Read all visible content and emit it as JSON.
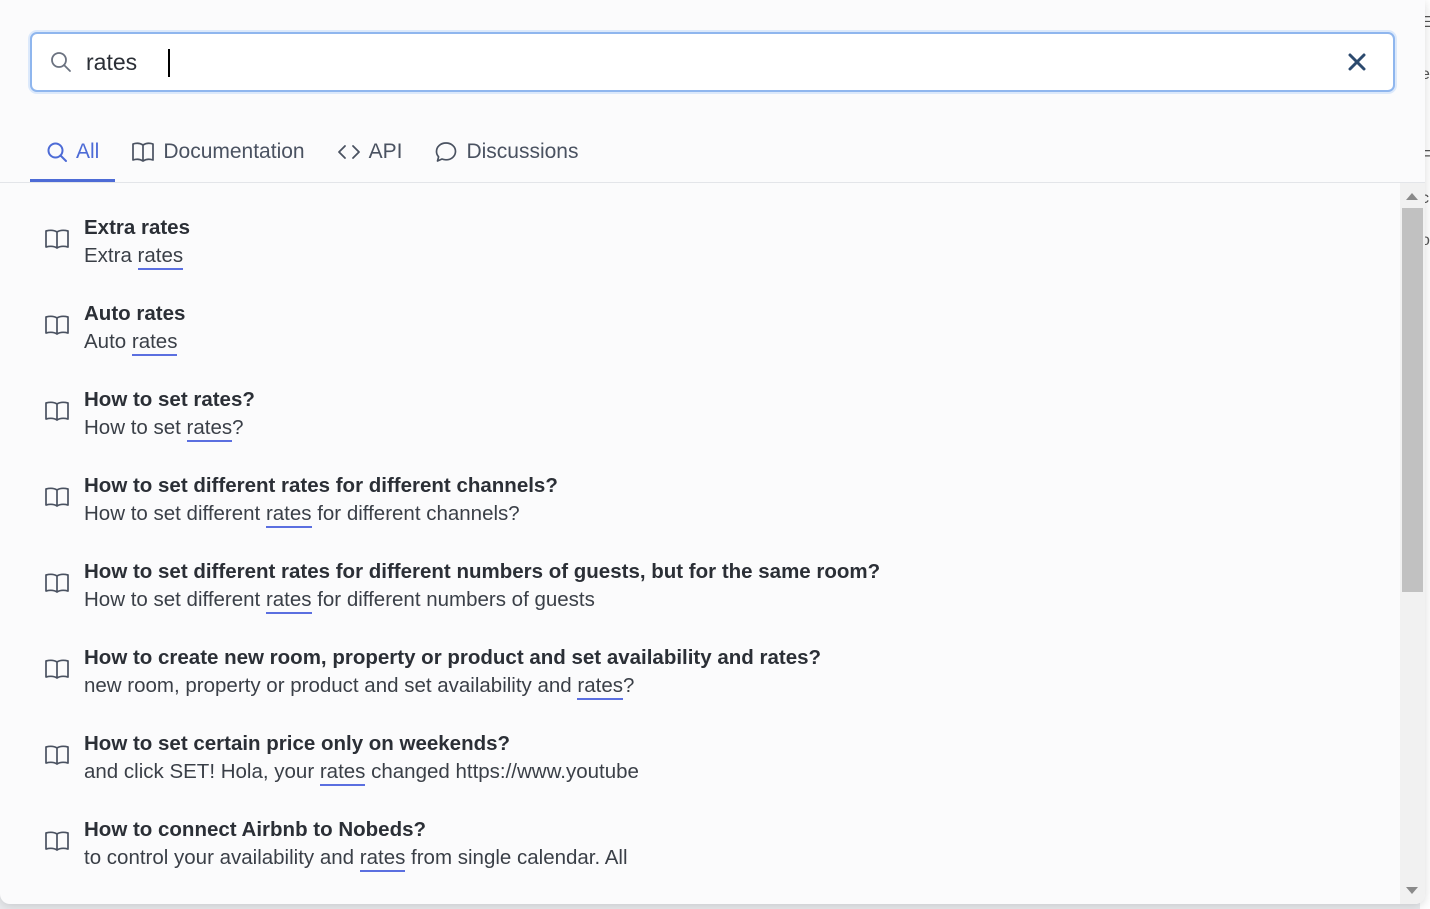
{
  "search": {
    "value": "rates",
    "clear_label": "×"
  },
  "tabs": [
    {
      "label": "All",
      "icon": "search-icon",
      "active": true
    },
    {
      "label": "Documentation",
      "icon": "book-icon",
      "active": false
    },
    {
      "label": "API",
      "icon": "code-icon",
      "active": false
    },
    {
      "label": "Discussions",
      "icon": "chat-bubble-icon",
      "active": false
    }
  ],
  "results": [
    {
      "title": "Extra rates",
      "snippet_before": "Extra ",
      "snippet_match": "rates",
      "snippet_after": ""
    },
    {
      "title": "Auto rates",
      "snippet_before": "Auto ",
      "snippet_match": "rates",
      "snippet_after": ""
    },
    {
      "title": "How to set rates?",
      "snippet_before": "How to set ",
      "snippet_match": "rates",
      "snippet_after": "?"
    },
    {
      "title": "How to set different rates for different channels?",
      "snippet_before": "How to set different ",
      "snippet_match": "rates",
      "snippet_after": " for different channels?"
    },
    {
      "title": "How to set different rates for different numbers of guests, but for the same room?",
      "snippet_before": "How to set different ",
      "snippet_match": "rates",
      "snippet_after": " for different numbers of guests"
    },
    {
      "title": "How to create new room, property or product and set availability and rates?",
      "snippet_before": "new room, property or product and set availability and ",
      "snippet_match": "rates",
      "snippet_after": "?"
    },
    {
      "title": "How to set certain price only on weekends?",
      "snippet_before": "and click SET! Hola, your ",
      "snippet_match": "rates",
      "snippet_after": " changed https://www.youtube"
    },
    {
      "title": "How to connect Airbnb to Nobeds?",
      "snippet_before": "to control your availability and ",
      "snippet_match": "rates",
      "snippet_after": " from single calendar. All"
    }
  ],
  "backdrop": {
    "letters": [
      "E",
      "e",
      "i",
      "F",
      "c",
      "o"
    ]
  },
  "colors": {
    "accent": "#4d6bd6",
    "search_border": "#8fb6ee",
    "match_underline": "#5b6fe0"
  }
}
